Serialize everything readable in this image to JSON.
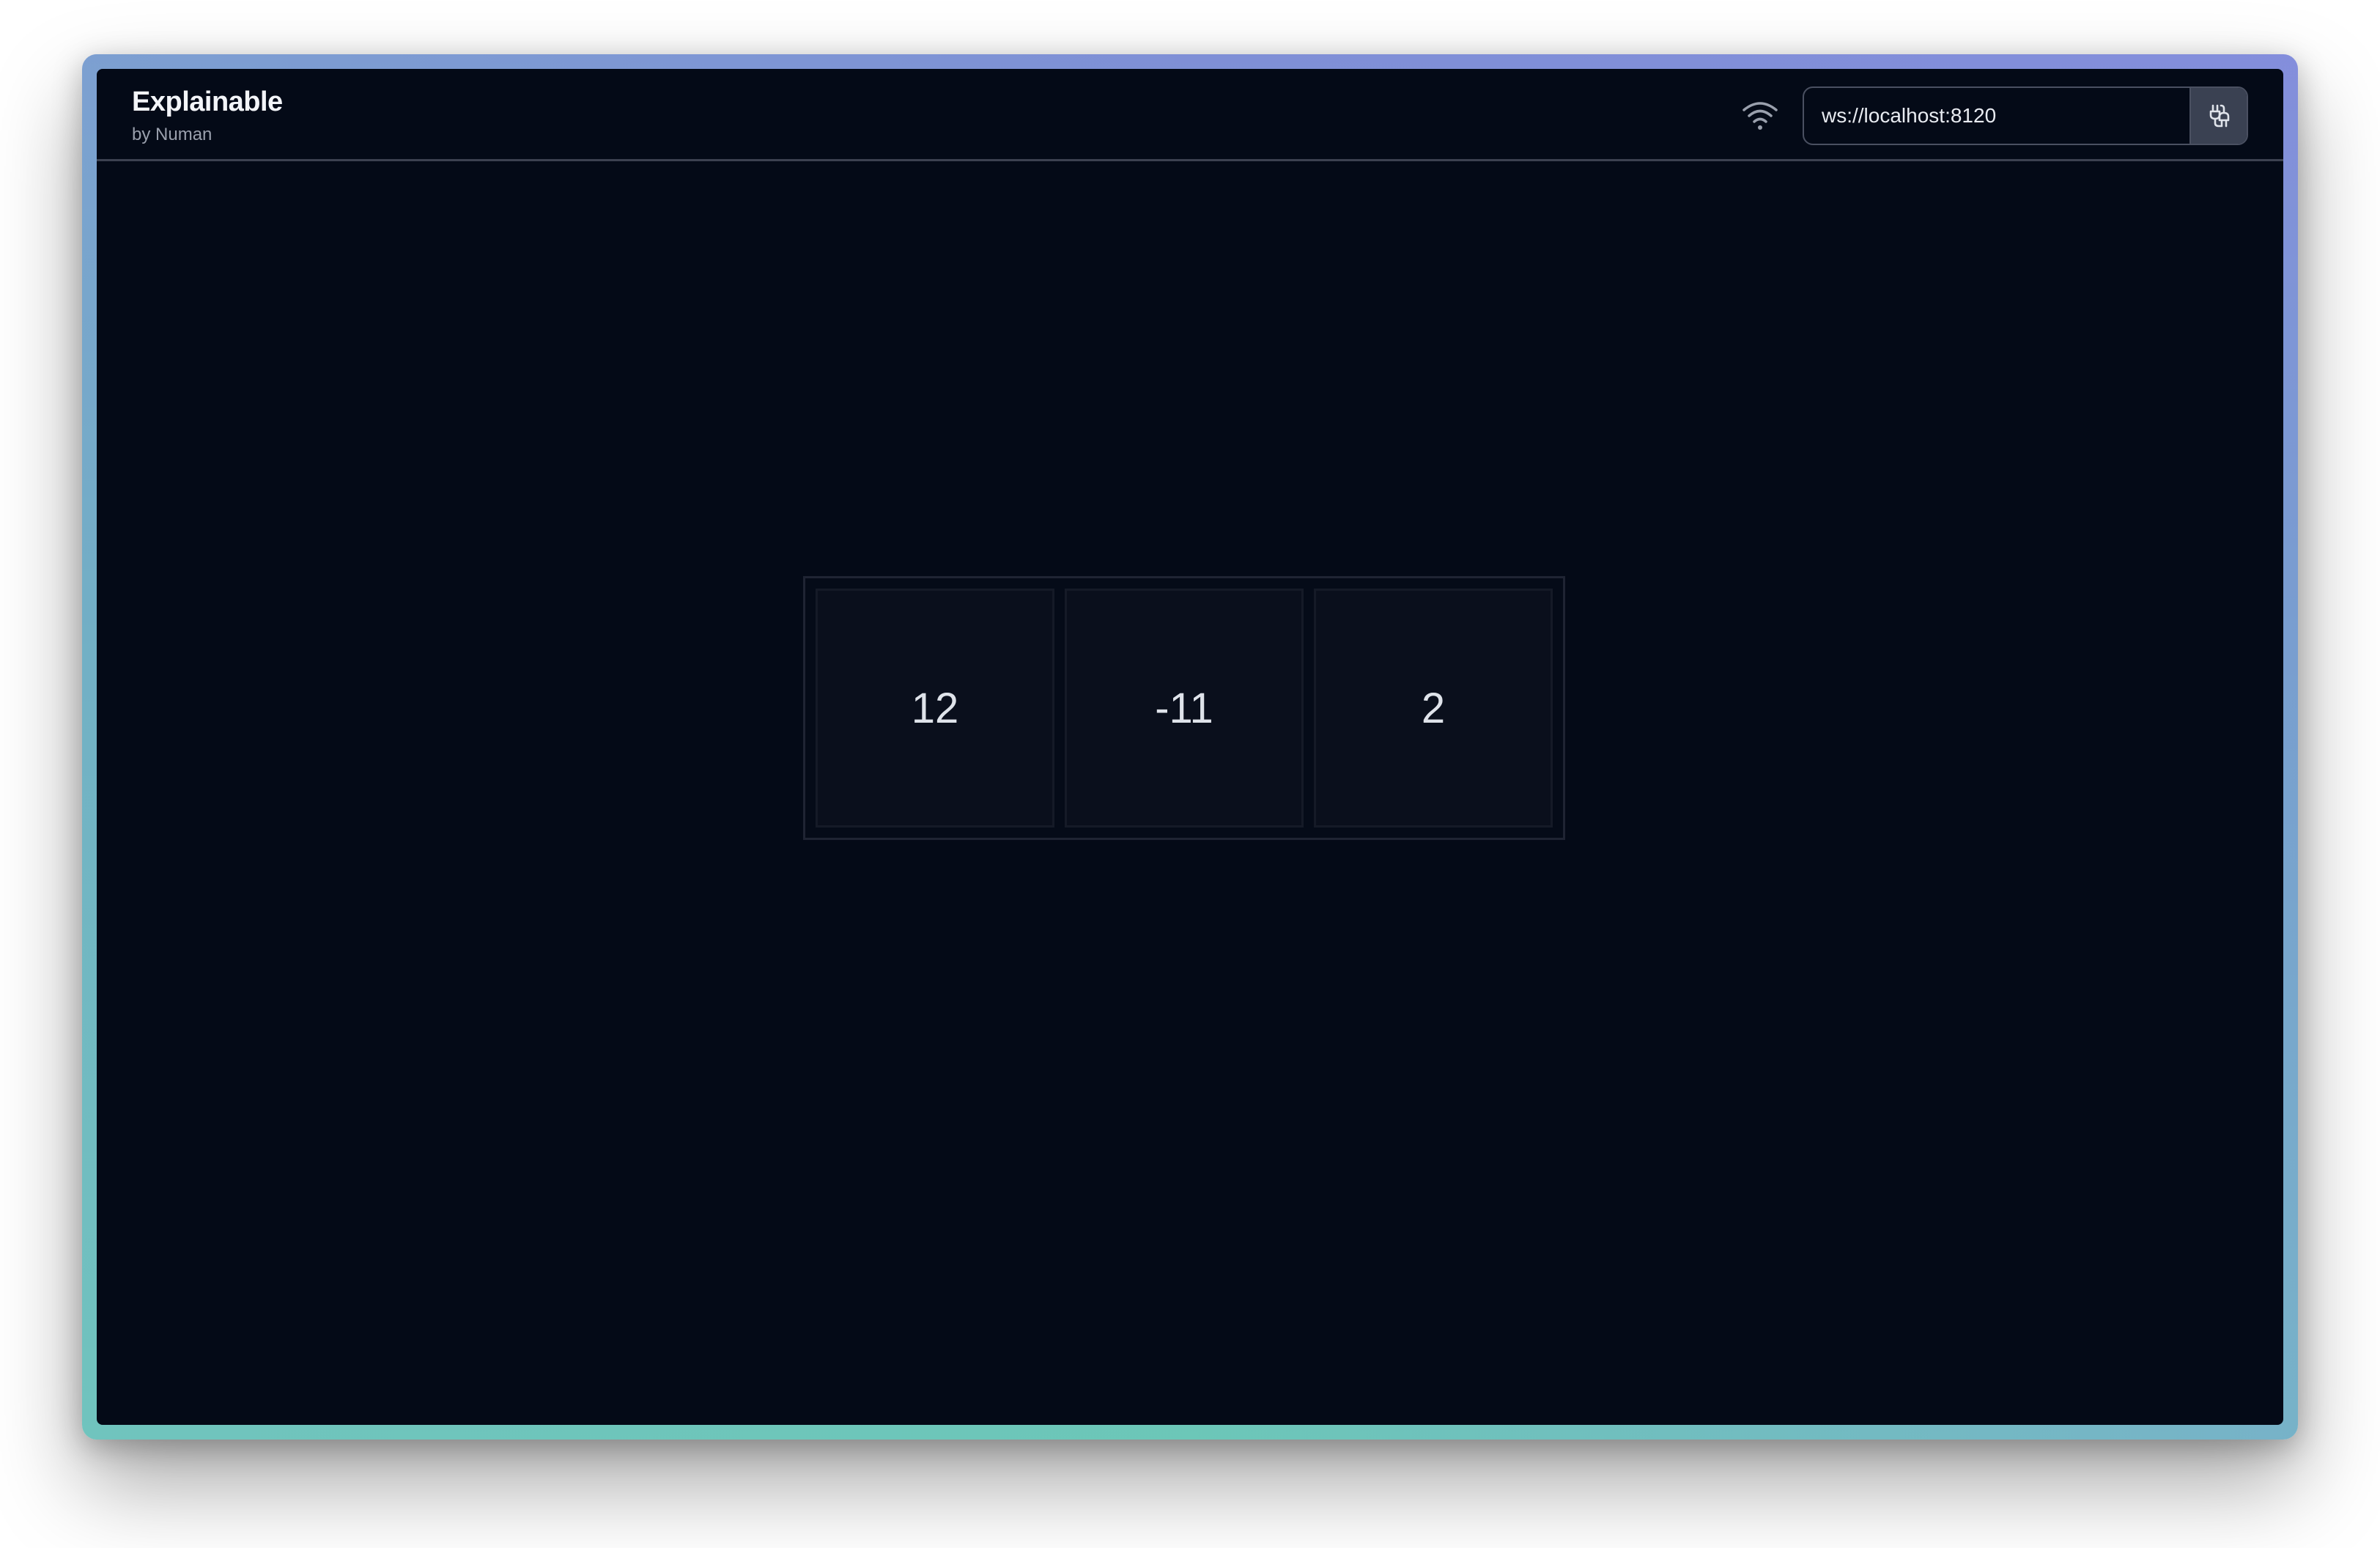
{
  "header": {
    "title": "Explainable",
    "subtitle": "by Numan",
    "wifi_icon": "wifi-icon",
    "connection": {
      "url_value": "ws://localhost:8120",
      "connect_icon": "connect-plug-icon"
    }
  },
  "array": {
    "cells": [
      "12",
      "-11",
      "2"
    ]
  },
  "colors": {
    "background": "#040a17",
    "cell_bg": "#0a0f1c",
    "frame_gradient_top": "#7f8fd6",
    "frame_gradient_bottom": "#6cc7b8"
  }
}
